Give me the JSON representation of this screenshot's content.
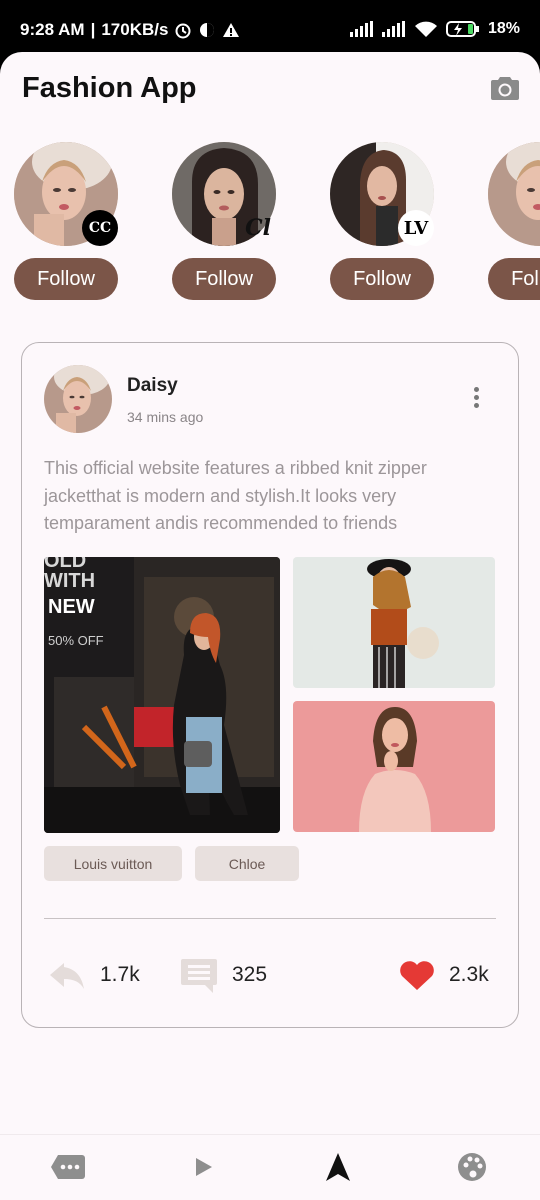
{
  "status_bar": {
    "time": "9:28 AM",
    "speed": "170KB/s",
    "battery": "18%"
  },
  "header": {
    "title": "Fashion App",
    "camera_icon": "camera-icon"
  },
  "stories": [
    {
      "follow_label": "Follow",
      "brand_icon": "chanel-logo-icon"
    },
    {
      "follow_label": "Follow",
      "brand_icon": "chloe-logo-icon"
    },
    {
      "follow_label": "Follow",
      "brand_icon": "lv-logo-icon"
    },
    {
      "follow_label": "Follow",
      "brand_icon": "chanel-logo-icon"
    }
  ],
  "post": {
    "author": "Daisy",
    "time": "34 mins ago",
    "text": "This official website features a ribbed knit zipper jacketthat is modern and stylish.It looks very temparament andis recommended to friends",
    "photo_overlay": {
      "line1": "OLD",
      "line2": "WITH",
      "line3": "NEW",
      "line4": "50% OFF"
    },
    "tags": [
      "Louis vuitton",
      "Chloe"
    ],
    "shares": "1.7k",
    "comments": "325",
    "likes": "2.3k"
  },
  "colors": {
    "accent": "#7b5548",
    "background": "#fdf8fb",
    "like": "#e53935",
    "tag_bg": "#e8e0de"
  },
  "bottom_nav": [
    "message-icon",
    "play-icon",
    "navigation-arrow-icon",
    "palette-icon"
  ]
}
